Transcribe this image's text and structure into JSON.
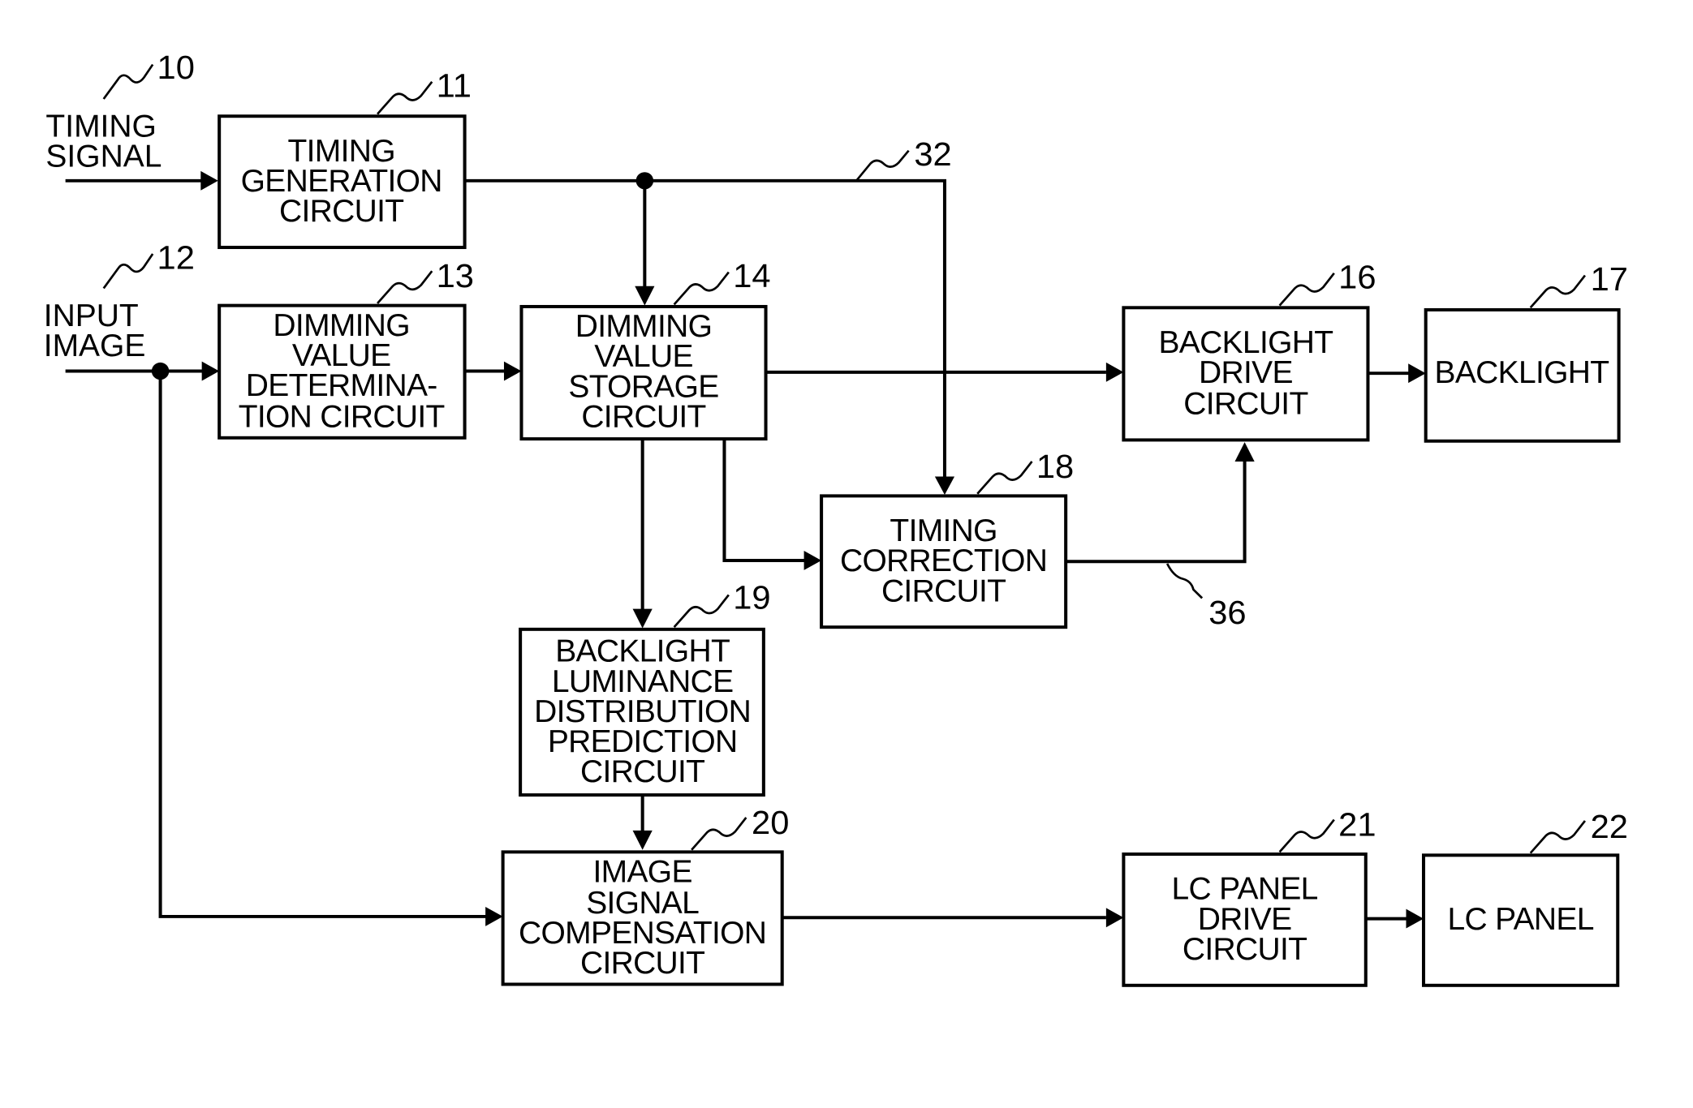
{
  "diagram": {
    "type": "block-diagram",
    "signals": {
      "timing_signal": {
        "ref": "10",
        "lines": [
          "TIMING",
          "SIGNAL"
        ]
      },
      "input_image": {
        "ref": "12",
        "lines": [
          "INPUT",
          "IMAGE"
        ]
      }
    },
    "blocks": {
      "b11": {
        "ref": "11",
        "lines": [
          "TIMING",
          "GENERATION",
          "CIRCUIT"
        ]
      },
      "b13": {
        "ref": "13",
        "lines": [
          "DIMMING",
          "VALUE",
          "DETERMINA-",
          "TION  CIRCUIT"
        ]
      },
      "b14": {
        "ref": "14",
        "lines": [
          "DIMMING",
          "VALUE",
          "STORAGE",
          "CIRCUIT"
        ]
      },
      "b16": {
        "ref": "16",
        "lines": [
          "BACKLIGHT",
          "DRIVE",
          "CIRCUIT"
        ]
      },
      "b17": {
        "ref": "17",
        "lines": [
          "BACKLIGHT"
        ]
      },
      "b18": {
        "ref": "18",
        "lines": [
          "TIMING",
          "CORRECTION",
          "CIRCUIT"
        ]
      },
      "b19": {
        "ref": "19",
        "lines": [
          "BACKLIGHT",
          "LUMINANCE",
          "DISTRIBUTION",
          "PREDICTION",
          "CIRCUIT"
        ]
      },
      "b20": {
        "ref": "20",
        "lines": [
          "IMAGE",
          "SIGNAL",
          "COMPENSATION",
          "CIRCUIT"
        ]
      },
      "b21": {
        "ref": "21",
        "lines": [
          "LC  PANEL",
          "DRIVE",
          "CIRCUIT"
        ]
      },
      "b22": {
        "ref": "22",
        "lines": [
          "LC  PANEL"
        ]
      }
    },
    "wire_refs": {
      "w32": "32",
      "w36": "36"
    },
    "connections": [
      {
        "from": "TIMING SIGNAL",
        "to": "11"
      },
      {
        "from": "11",
        "to": "14"
      },
      {
        "from": "11",
        "to": "18",
        "ref": "32"
      },
      {
        "from": "INPUT IMAGE",
        "to": "13"
      },
      {
        "from": "INPUT IMAGE",
        "to": "20"
      },
      {
        "from": "13",
        "to": "14"
      },
      {
        "from": "14",
        "to": "16"
      },
      {
        "from": "14",
        "to": "18"
      },
      {
        "from": "14",
        "to": "19"
      },
      {
        "from": "18",
        "to": "16",
        "ref": "36"
      },
      {
        "from": "16",
        "to": "17"
      },
      {
        "from": "19",
        "to": "20"
      },
      {
        "from": "20",
        "to": "21"
      },
      {
        "from": "21",
        "to": "22"
      }
    ]
  }
}
